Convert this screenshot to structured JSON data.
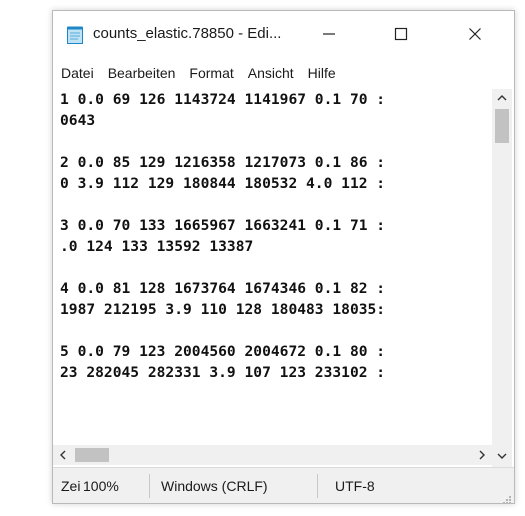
{
  "window": {
    "title": "counts_elastic.78850 - Edi...",
    "controls": {
      "minimize": "—",
      "maximize": "☐",
      "close": "✕"
    }
  },
  "menu": [
    "Datei",
    "Bearbeiten",
    "Format",
    "Ansicht",
    "Hilfe"
  ],
  "editor": {
    "lines": [
      "1 0.0 69 126 1143724 1141967 0.1 70 :",
      "0643",
      "",
      "2 0.0 85 129 1216358 1217073 0.1 86 :",
      "0 3.9 112 129 180844 180532 4.0 112 :",
      "",
      "3 0.0 70 133 1665967 1663241 0.1 71 :",
      ".0 124 133 13592 13387",
      "",
      "4 0.0 81 128 1673764 1674346 0.1 82 :",
      "1987 212195 3.9 110 128 180483 18035:",
      "",
      "5 0.0 79 123 2004560 2004672 0.1 80 :",
      "23 282045 282331 3.9 107 123 233102 :"
    ]
  },
  "statusbar": {
    "position": "Zei",
    "zoom": "100%",
    "line_ending": "Windows (CRLF)",
    "encoding": "UTF-8"
  },
  "icons": {
    "app": "notepad-icon",
    "scroll_up": "chevron-up-icon",
    "scroll_down": "chevron-down-icon",
    "scroll_left": "chevron-left-icon",
    "scroll_right": "chevron-right-icon",
    "grip": "resize-grip-icon"
  },
  "colors": {
    "accent": "#1e88c7",
    "scroll_track": "#f0f0f0",
    "scroll_thumb": "#c2c2c2",
    "text": "#111111"
  }
}
